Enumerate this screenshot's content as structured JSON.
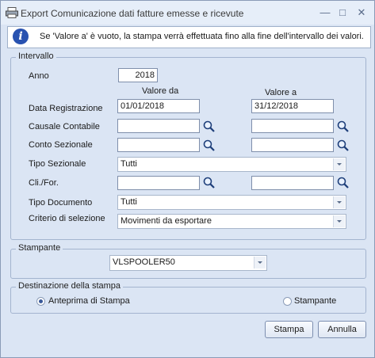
{
  "window": {
    "title": "Export Comunicazione dati fatture emesse e ricevute",
    "info_message": "Se 'Valore a' è vuoto, la stampa verrà effettuata fino alla fine dell'intervallo dei valori."
  },
  "intervallo": {
    "group_label": "Intervallo",
    "anno_label": "Anno",
    "anno_value": "2018",
    "valore_da_header": "Valore da",
    "valore_a_header": "Valore a",
    "data_registrazione_label": "Data Registrazione",
    "data_da": "01/01/2018",
    "data_a": "31/12/2018",
    "causale_label": "Causale Contabile",
    "causale_da": "",
    "causale_a": "",
    "conto_sezionale_label": "Conto Sezionale",
    "conto_da": "",
    "conto_a": "",
    "tipo_sezionale_label": "Tipo Sezionale",
    "tipo_sezionale_value": "Tutti",
    "clifor_label": "Cli./For.",
    "clifor_da": "",
    "clifor_a": "",
    "tipo_documento_label": "Tipo Documento",
    "tipo_documento_value": "Tutti",
    "criterio_label": "Criterio di selezione",
    "criterio_value": "Movimenti da esportare"
  },
  "stampante": {
    "group_label": "Stampante",
    "value": "VLSPOOLER50"
  },
  "destinazione": {
    "group_label": "Destinazione della stampa",
    "anteprima_label": "Anteprima di Stampa",
    "stampante_label": "Stampante",
    "selected": "anteprima"
  },
  "buttons": {
    "stampa": "Stampa",
    "annulla": "Annulla"
  }
}
